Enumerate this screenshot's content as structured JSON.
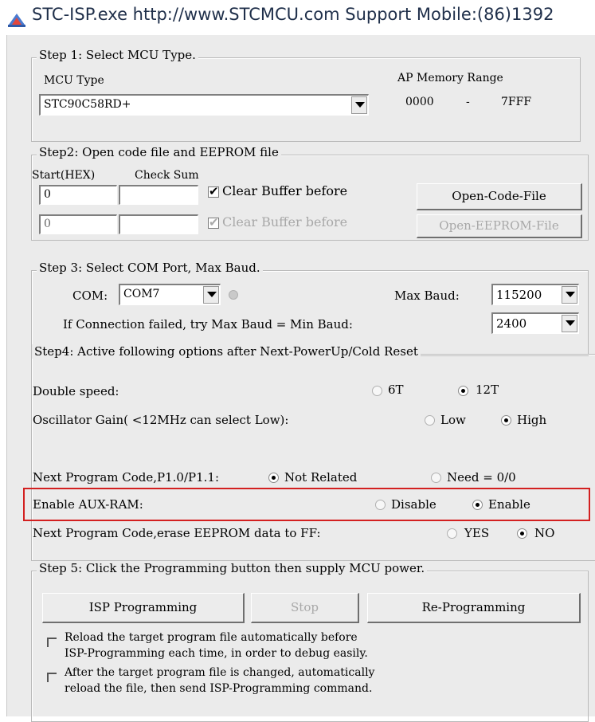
{
  "window": {
    "title": "STC-ISP.exe  http://www.STCMCU.com  Support Mobile:(86)1392"
  },
  "step1": {
    "legend": "Step 1: Select MCU Type.",
    "mcu_type_label": "MCU Type",
    "mcu_type_value": "STC90C58RD+",
    "ap_memory_label": "AP Memory Range",
    "ap_start": "0000",
    "ap_dash": "-",
    "ap_end": "7FFF"
  },
  "step2": {
    "legend": "Step2: Open code file and EEPROM file",
    "start_hex_label": "Start(HEX)",
    "check_sum_label": "Check Sum",
    "code_start": "0",
    "code_checksum": "",
    "code_clear_label": "Clear Buffer before",
    "open_code_button": "Open-Code-File",
    "eeprom_start": "0",
    "eeprom_checksum": "",
    "eeprom_clear_label": "Clear Buffer before",
    "open_eeprom_button": "Open-EEPROM-File"
  },
  "step3": {
    "legend": "Step 3: Select COM Port, Max Baud.",
    "com_label": "COM:",
    "com_value": "COM7",
    "max_baud_label": "Max Baud:",
    "max_baud_value": "115200",
    "fail_label": "If Connection failed, try Max Baud = Min Baud:",
    "min_baud_value": "2400"
  },
  "step4": {
    "legend": "Step4: Active following options after Next-PowerUp/Cold Reset",
    "double_speed_label": "Double speed:",
    "opt_6t": "6T",
    "opt_12t": "12T",
    "osc_gain_label": "Oscillator Gain( <12MHz can select Low):",
    "opt_low": "Low",
    "opt_high": "High",
    "next_code_label": "Next Program Code,P1.0/P1.1:",
    "opt_not_related": "Not Related",
    "opt_need": "Need = 0/0",
    "aux_ram_label": "Enable AUX-RAM:",
    "opt_disable": "Disable",
    "opt_enable": "Enable",
    "erase_label": "Next Program Code,erase EEPROM data to FF:",
    "opt_yes": "YES",
    "opt_no": "NO"
  },
  "step5": {
    "legend": "Step 5: Click the Programming button then supply MCU power.",
    "isp_button": "ISP Programming",
    "stop_button": "Stop",
    "reprog_button": "Re-Programming",
    "reload1_line1": "Reload the target program file automatically before",
    "reload1_line2": "ISP-Programming each time, in order to debug easily.",
    "reload2_line1": "After the target program file is changed, automatically",
    "reload2_line2": "reload the file, then send ISP-Programming command."
  },
  "colors": {
    "highlight": "#d32020",
    "window_bg": "#ebebeb"
  }
}
